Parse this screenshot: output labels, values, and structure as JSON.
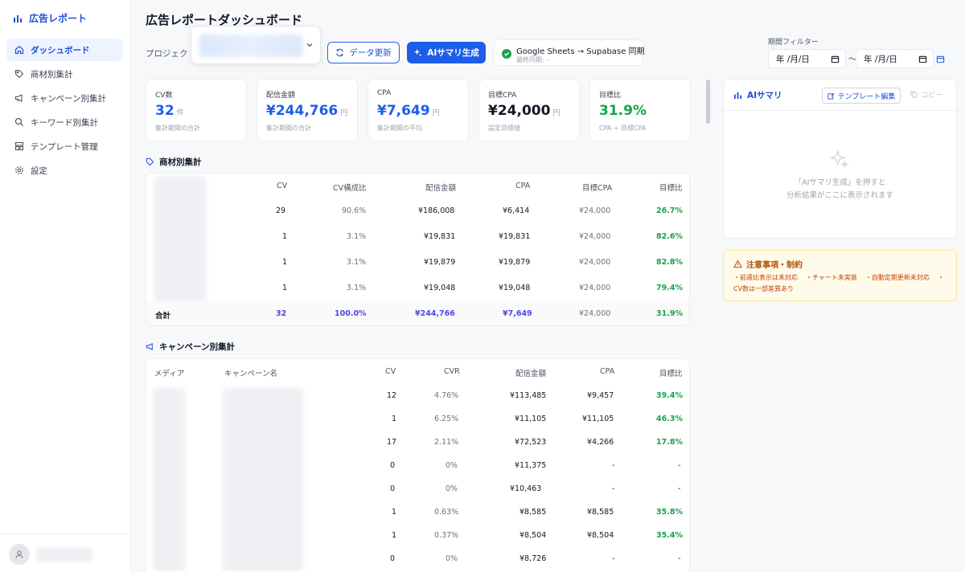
{
  "sidebar": {
    "brand": "広告レポート",
    "items": [
      {
        "label": "ダッシュボード",
        "icon": "home-icon",
        "active": true
      },
      {
        "label": "商材別集計",
        "icon": "tag-icon",
        "active": false
      },
      {
        "label": "キャンペーン別集計",
        "icon": "megaphone-icon",
        "active": false
      },
      {
        "label": "キーワード別集計",
        "icon": "search-icon",
        "active": false
      },
      {
        "label": "テンプレート管理",
        "icon": "layout-icon",
        "active": false
      },
      {
        "label": "設定",
        "icon": "gear-icon",
        "active": false
      }
    ]
  },
  "header": {
    "title": "広告レポートダッシュボード",
    "project_label": "プロジェクト",
    "refresh_label": "データ更新",
    "ai_summary_label": "AIサマリ生成",
    "sync_title": "Google Sheets → Supabase 同期",
    "sync_sub": "最終同期: -"
  },
  "period": {
    "label": "期間フィルター",
    "start": "年 /月/日",
    "end": "年 /月/日",
    "separator": "～"
  },
  "kpis": [
    {
      "label": "CV数",
      "value": "32",
      "unit": "件",
      "sub": "集計期間の合計",
      "color": "#1d5ee8"
    },
    {
      "label": "配信金額",
      "value": "¥244,766",
      "unit": "円",
      "sub": "集計期間の合計",
      "color": "#1d5ee8"
    },
    {
      "label": "CPA",
      "value": "¥7,649",
      "unit": "円",
      "sub": "集計期間の平均",
      "color": "#1d5ee8"
    },
    {
      "label": "目標CPA",
      "value": "¥24,000",
      "unit": "円",
      "sub": "設定目標値",
      "color": "#111827"
    },
    {
      "label": "目標比",
      "value": "31.9%",
      "unit": "",
      "sub": "CPA ÷ 目標CPA",
      "color": "#16a34a"
    }
  ],
  "product_table": {
    "title": "商材別集計",
    "headers": [
      "CV",
      "CV構成比",
      "配信金額",
      "CPA",
      "目標CPA",
      "目標比"
    ],
    "rows": [
      [
        "29",
        "90.6%",
        "¥186,008",
        "¥6,414",
        "¥24,000",
        "26.7%"
      ],
      [
        "1",
        "3.1%",
        "¥19,831",
        "¥19,831",
        "¥24,000",
        "82.6%"
      ],
      [
        "1",
        "3.1%",
        "¥19,879",
        "¥19,879",
        "¥24,000",
        "82.8%"
      ],
      [
        "1",
        "3.1%",
        "¥19,048",
        "¥19,048",
        "¥24,000",
        "79.4%"
      ]
    ],
    "total": [
      "合計",
      "32",
      "100.0%",
      "¥244,766",
      "¥7,649",
      "¥24,000",
      "31.9%"
    ]
  },
  "campaign_table": {
    "title": "キャンペーン別集計",
    "headers": [
      "メディア",
      "キャンペーン名",
      "CV",
      "CVR",
      "配信金額",
      "CPA",
      "目標比"
    ],
    "rows": [
      [
        "12",
        "4.76%",
        "¥113,485",
        "¥9,457",
        "39.4%"
      ],
      [
        "1",
        "6.25%",
        "¥11,105",
        "¥11,105",
        "46.3%"
      ],
      [
        "17",
        "2.11%",
        "¥72,523",
        "¥4,266",
        "17.8%"
      ],
      [
        "0",
        "0%",
        "¥11,375",
        "-",
        "-"
      ],
      [
        "0",
        "0%",
        "¥10,463",
        "-",
        "-"
      ],
      [
        "1",
        "0.63%",
        "¥8,585",
        "¥8,585",
        "35.8%"
      ],
      [
        "1",
        "0.37%",
        "¥8,504",
        "¥8,504",
        "35.4%"
      ],
      [
        "0",
        "0%",
        "¥8,726",
        "-",
        "-"
      ]
    ]
  },
  "ai_panel": {
    "title": "AIサマリ",
    "template_edit": "テンプレート編集",
    "copy": "コピー",
    "empty_line1": "「AIサマリ生成」を押すと",
    "empty_line2": "分析結果がここに表示されます"
  },
  "notice": {
    "title": "注意事項・制約",
    "items": [
      "・前週比表示は未対応",
      "・チャート未実装",
      "・自動定期更新未対応",
      "・CV数は一部差異あり"
    ]
  }
}
